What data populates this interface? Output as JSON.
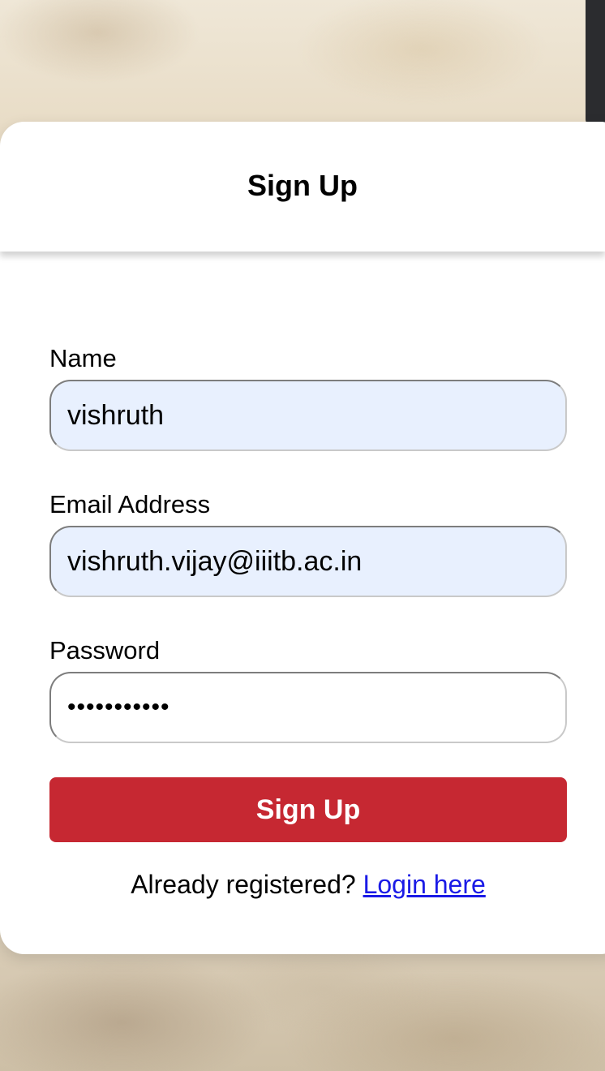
{
  "header": {
    "title": "Sign Up"
  },
  "form": {
    "name": {
      "label": "Name",
      "value": "vishruth"
    },
    "email": {
      "label": "Email Address",
      "value": "vishruth.vijay@iiitb.ac.in"
    },
    "password": {
      "label": "Password",
      "value": "vishruth123"
    },
    "submit_label": "Sign Up"
  },
  "footer": {
    "prompt": "Already registered?",
    "link_label": "Login here"
  },
  "colors": {
    "accent": "#c62832",
    "autofill_bg": "#e8f0fe",
    "link": "#1a1ae6"
  }
}
